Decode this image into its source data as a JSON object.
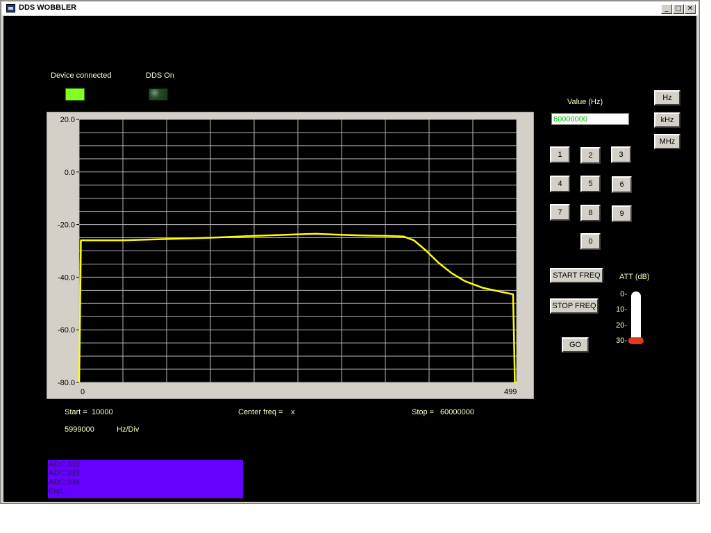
{
  "window": {
    "title": "DDS WOBBLER",
    "controls": {
      "minimize": "_",
      "maximize": "□",
      "close": "✕"
    }
  },
  "indicators": {
    "device_connected": {
      "label": "Device connected",
      "state": "on",
      "color": "#80ff20"
    },
    "dds_on": {
      "label": "DDS On",
      "state": "off",
      "color": "#1c3a1c"
    }
  },
  "graph": {
    "y_ticks": [
      "20.0",
      "0.0",
      "-20.0",
      "-40.0",
      "-60.0",
      "-80.0"
    ],
    "x_start_label": "0",
    "x_end_label": "499",
    "trace_color": "#ffff00"
  },
  "chart_data": {
    "type": "line",
    "ylim": [
      -80,
      20
    ],
    "xlim": [
      0,
      499
    ],
    "series": [
      {
        "x": [
          0,
          1,
          2,
          50,
          100,
          150,
          200,
          250,
          270,
          300,
          330,
          350,
          370,
          382,
          396,
          410,
          425,
          440,
          460,
          480,
          495,
          496,
          497,
          499
        ],
        "y": [
          -80,
          -54,
          -26,
          -26,
          -25.5,
          -25,
          -24.3,
          -23.7,
          -23.5,
          -23.9,
          -24.2,
          -24.3,
          -24.5,
          -26,
          -30,
          -34.5,
          -38.5,
          -41.5,
          -44,
          -45.5,
          -46.5,
          -62,
          -80,
          -80
        ]
      }
    ]
  },
  "info": {
    "start_label": "Start =",
    "start_value": "10000",
    "center_label": "Center freq =",
    "center_value": "x",
    "stop_label": "Stop =",
    "stop_value": "60000000",
    "hz_div_value": "5999000",
    "hz_div_label": "Hz/Div"
  },
  "log": [
    "ADC:339",
    "ADC:339",
    "ADC:339",
    "End..."
  ],
  "value": {
    "label": "Value (Hz)",
    "input": "60000000"
  },
  "units": {
    "hz": "Hz",
    "khz": "kHz",
    "mhz": "MHz"
  },
  "keypad": {
    "k1": "1",
    "k2": "2",
    "k3": "3",
    "k4": "4",
    "k5": "5",
    "k6": "6",
    "k7": "7",
    "k8": "8",
    "k9": "9",
    "k0": "0"
  },
  "actions": {
    "start_freq": "START FREQ",
    "stop_freq": "STOP FREQ",
    "go": "GO"
  },
  "att": {
    "label": "ATT (dB)",
    "ticks": [
      "0-",
      "10-",
      "20-",
      "30-"
    ],
    "value_db": 30
  }
}
